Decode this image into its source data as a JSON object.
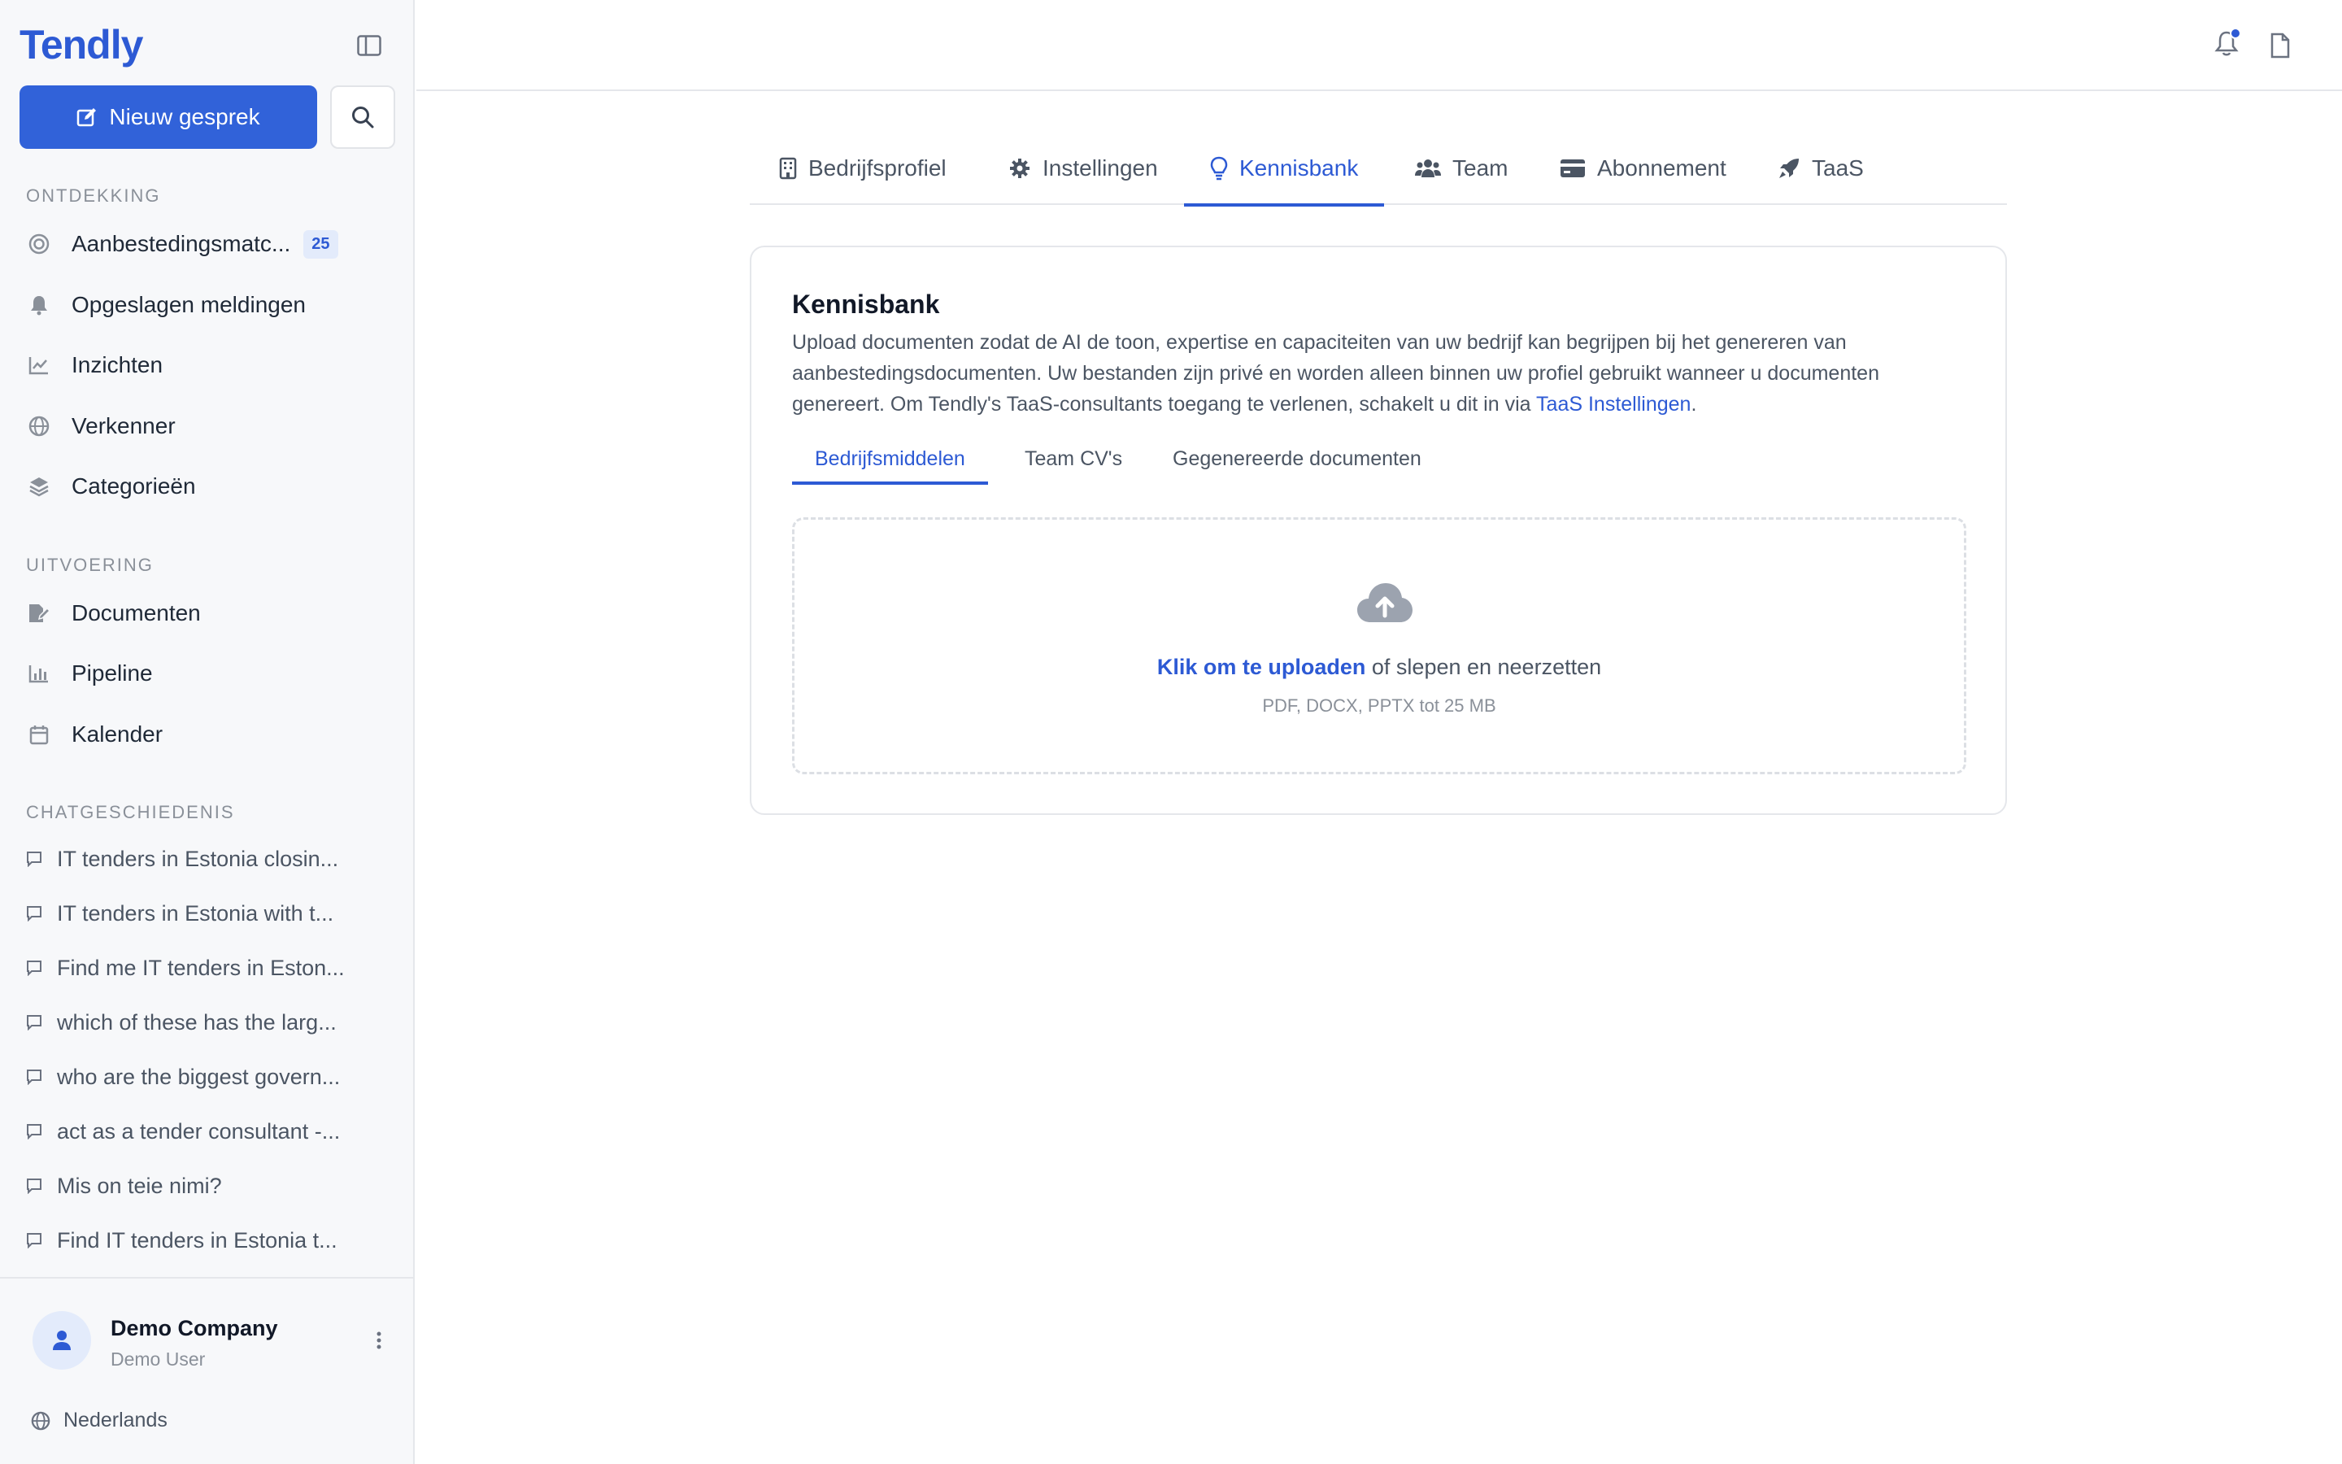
{
  "app": {
    "logo": "Tendly",
    "new_chat_label": "Nieuw gesprek"
  },
  "sidebar": {
    "discovery_title": "ONTDEKKING",
    "discovery_items": [
      {
        "label": "Aanbestedingsmatc...",
        "icon": "target-icon",
        "badge": "25"
      },
      {
        "label": "Opgeslagen meldingen",
        "icon": "bell-icon"
      },
      {
        "label": "Inzichten",
        "icon": "line-chart-icon"
      },
      {
        "label": "Verkenner",
        "icon": "globe-icon"
      },
      {
        "label": "Categorieën",
        "icon": "layers-icon"
      }
    ],
    "execution_title": "UITVOERING",
    "execution_items": [
      {
        "label": "Documenten",
        "icon": "document-edit-icon"
      },
      {
        "label": "Pipeline",
        "icon": "bar-chart-icon"
      },
      {
        "label": "Kalender",
        "icon": "calendar-icon"
      }
    ],
    "history_title": "CHATGESCHIEDENIS",
    "history_items": [
      "IT tenders in Estonia closin...",
      "IT tenders in Estonia with t...",
      "Find me IT tenders in Eston...",
      "which of these has the larg...",
      "who are the biggest govern...",
      "act as a tender consultant -...",
      "Mis on teie nimi?",
      "Find IT tenders in Estonia t..."
    ],
    "user": {
      "company": "Demo Company",
      "name": "Demo User"
    },
    "language": "Nederlands"
  },
  "tabs": [
    {
      "label": "Bedrijfsprofiel",
      "icon": "building-icon"
    },
    {
      "label": "Instellingen",
      "icon": "gear-icon"
    },
    {
      "label": "Kennisbank",
      "icon": "lightbulb-icon",
      "active": true
    },
    {
      "label": "Team",
      "icon": "users-icon"
    },
    {
      "label": "Abonnement",
      "icon": "credit-card-icon"
    },
    {
      "label": "TaaS",
      "icon": "rocket-icon"
    }
  ],
  "card": {
    "title": "Kennisbank",
    "description": "Upload documenten zodat de AI de toon, expertise en capaciteiten van uw bedrijf kan begrijpen bij het genereren van aanbestedingsdocumenten. Uw bestanden zijn privé en worden alleen binnen uw profiel gebruikt wanneer u documenten genereert. Om Tendly's TaaS-consultants toegang te verlenen, schakelt u dit in via",
    "description_link": "TaaS Instellingen",
    "description_end": ".",
    "subtabs": [
      "Bedrijfsmiddelen",
      "Team CV's",
      "Gegenereerde documenten"
    ],
    "upload": {
      "link_text": "Klik om te uploaden",
      "rest_text": " of slepen en neerzetten",
      "hint": "PDF, DOCX, PPTX tot 25 MB"
    }
  },
  "colors": {
    "accent": "#2d5ad4",
    "primary_button": "#3162d9"
  }
}
